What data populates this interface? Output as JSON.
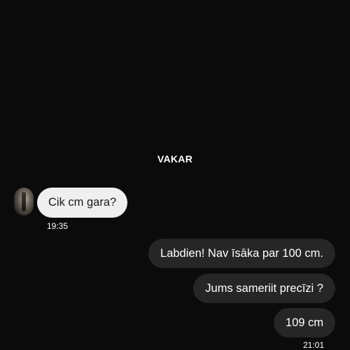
{
  "day_divider": "VAKAR",
  "incoming": {
    "text": "Cik cm gara?",
    "time": "19:35"
  },
  "outgoing": [
    {
      "text": "Labdien! Nav īsāka par 100 cm."
    },
    {
      "text": "Jums sameriit precīzi ?"
    },
    {
      "text": "109 cm"
    }
  ],
  "outgoing_time": "21:01",
  "colors": {
    "background": "#0b0b0b",
    "incoming_bubble": "#efefef",
    "outgoing_bubble": "#262626"
  }
}
